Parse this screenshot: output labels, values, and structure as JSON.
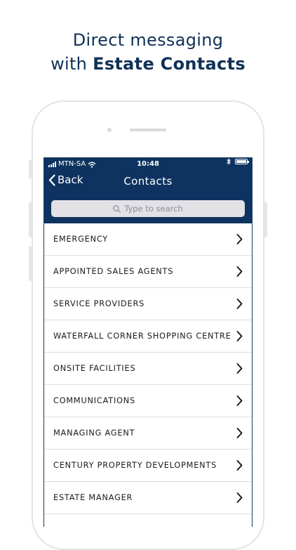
{
  "promo": {
    "line1": "Direct messaging",
    "line2_prefix": "with ",
    "line2_bold": "Estate Contacts"
  },
  "status_bar": {
    "carrier": "MTN-SA",
    "time": "10:48"
  },
  "nav": {
    "back_label": "Back",
    "title": "Contacts"
  },
  "search": {
    "placeholder": "Type to search"
  },
  "contacts": [
    "EMERGENCY",
    "APPOINTED SALES AGENTS",
    "SERVICE PROVIDERS",
    "WATERFALL CORNER SHOPPING CENTRE",
    "ONSITE FACILITIES",
    "COMMUNICATIONS",
    "MANAGING AGENT",
    "CENTURY PROPERTY DEVELOPMENTS",
    "ESTATE MANAGER"
  ],
  "colors": {
    "nav_background": "#0e3360",
    "headline": "#0f3157",
    "search_background": "#e1e1e6"
  }
}
